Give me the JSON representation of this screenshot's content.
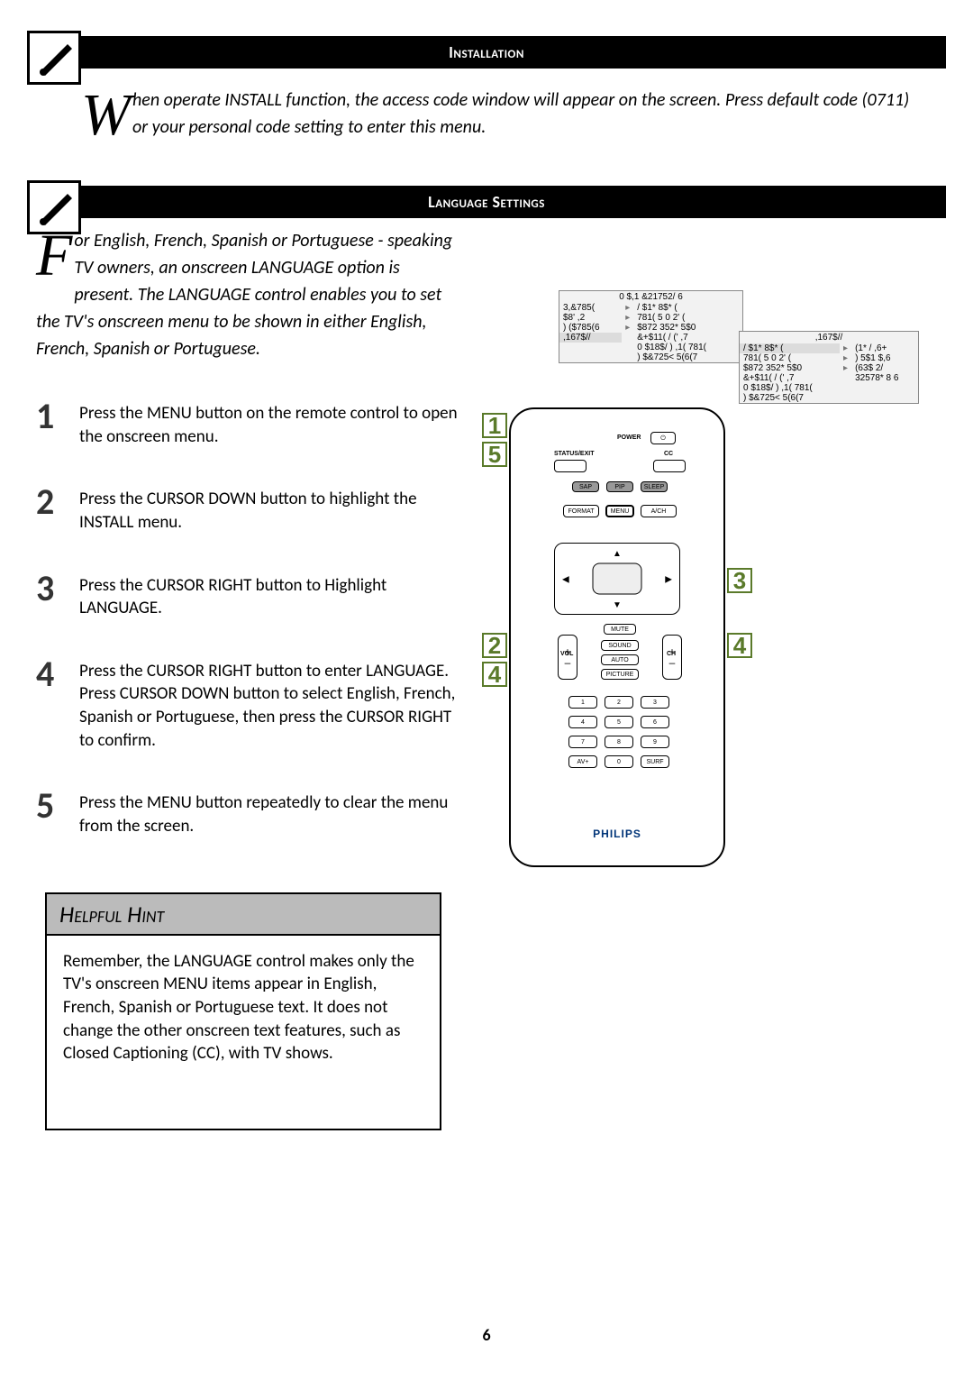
{
  "section1": {
    "title": "Installation",
    "dropcap": "W",
    "intro": "hen operate INSTALL function, the access code window will appear on the screen. Press default code (0711) or your personal code setting to enter this menu."
  },
  "section2": {
    "title": "Language Settings",
    "dropcap": "F",
    "intro": "or English, French, Spanish or Portuguese - speaking TV owners, an onscreen LANGUAGE option is present. The LANGUAGE control enables you to set the TV's onscreen menu to be shown in either English, French, Spanish or Portuguese."
  },
  "steps": {
    "s1": "Press the MENU button on the remote control to open the onscreen menu.",
    "s2": "Press the CURSOR DOWN button to highlight the INSTALL menu.",
    "s3": "Press the CURSOR RIGHT button to Highlight LANGUAGE.",
    "s4": "Press the CURSOR RIGHT button to enter LANGUAGE. Press CURSOR DOWN button to select English, French, Spanish or Portuguese, then press the CURSOR RIGHT to confirm.",
    "s5": "Press the MENU  button repeatedly to clear the menu from the screen."
  },
  "hint": {
    "title": "Helpful Hint",
    "body": "Remember, the LANGUAGE control makes only the TV's onscreen MENU items appear in English, French, Spanish or Portuguese text. It does not change the other onscreen text features, such as Closed Captioning (CC), with TV shows."
  },
  "menu1": {
    "hdr": "0 $,1 &21752/ 6",
    "rows": [
      [
        "3,&785(",
        "▸",
        "/ $1* 8$* ("
      ],
      [
        "$8' ,2",
        "▸",
        "781( 5 0 2' ("
      ],
      [
        ") ($785(6",
        "▸",
        "$872 352* 5$0"
      ],
      [
        ",167$//",
        "",
        "&+$11( / (' ,7"
      ],
      [
        "",
        "",
        "0 $18$/ ) ,1( 781("
      ],
      [
        "",
        "",
        ") $&725< 5(6(7"
      ]
    ]
  },
  "menu2": {
    "hdr": ",167$//",
    "rows": [
      [
        "/ $1* 8$* (",
        "▸",
        "(1* / ,6+"
      ],
      [
        "781( 5 0 2' (",
        "▸",
        ") 5$1 $,6"
      ],
      [
        "$872 352* 5$0",
        "▸",
        "(63$  2/"
      ],
      [
        "&+$11( / (' ,7",
        "",
        "32578* 8 6"
      ],
      [
        "0 $18$/ ) ,1( 781(",
        "",
        ""
      ],
      [
        ") $&725< 5(6(7",
        "",
        ""
      ]
    ]
  },
  "remote": {
    "power": "POWER",
    "status": "STATUS/EXIT",
    "cc": "CC",
    "sap": "SAP",
    "pip": "PIP",
    "sleep": "SLEEP",
    "format": "FORMAT",
    "menu": "MENU",
    "avch": "A/CH",
    "mute": "MUTE",
    "vol": "VOL",
    "ch": "CH",
    "sound": "SOUND",
    "auto": "AUTO",
    "picture": "PICTURE",
    "n1": "1",
    "n2": "2",
    "n3": "3",
    "n4": "4",
    "n5": "5",
    "n6": "6",
    "n7": "7",
    "n8": "8",
    "n9": "9",
    "n0": "0",
    "av": "AV+",
    "surf": "SURF",
    "brand": "PHILIPS"
  },
  "callouts": {
    "c1": "1",
    "c5": "5",
    "c2": "2",
    "c4": "4",
    "c3": "3",
    "c4b": "4"
  },
  "page": "6"
}
